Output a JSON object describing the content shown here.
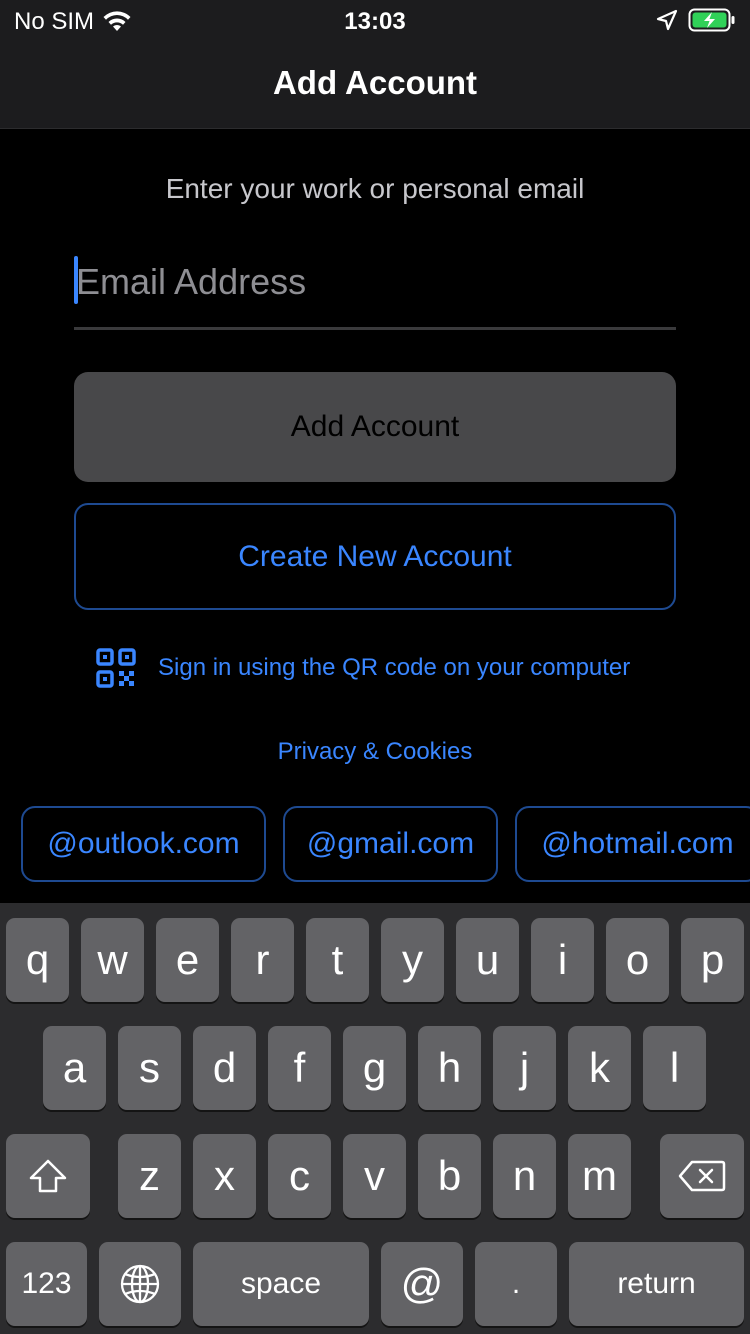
{
  "status_bar": {
    "carrier": "No SIM",
    "time": "13:03"
  },
  "nav": {
    "title": "Add Account"
  },
  "form": {
    "prompt": "Enter your work or personal email",
    "email_placeholder": "Email Address",
    "email_value": "",
    "add_account_label": "Add Account",
    "create_account_label": "Create New Account",
    "qr_label": "Sign in using the QR code on your computer",
    "privacy_label": "Privacy & Cookies"
  },
  "domain_suggestions": [
    "@outlook.com",
    "@gmail.com",
    "@hotmail.com"
  ],
  "keyboard": {
    "row1": [
      "q",
      "w",
      "e",
      "r",
      "t",
      "y",
      "u",
      "i",
      "o",
      "p"
    ],
    "row2": [
      "a",
      "s",
      "d",
      "f",
      "g",
      "h",
      "j",
      "k",
      "l"
    ],
    "row3": [
      "z",
      "x",
      "c",
      "v",
      "b",
      "n",
      "m"
    ],
    "numbers_label": "123",
    "space_label": "space",
    "at_label": "@",
    "dot_label": ".",
    "return_label": "return"
  },
  "colors": {
    "accent": "#3a86ff",
    "chip_border": "#1e4a91",
    "keyboard_bg": "#2c2c2e",
    "key_bg": "#636366",
    "key_dark_bg": "#434345",
    "battery_fill": "#30d158"
  },
  "icons": [
    "wifi-icon",
    "location-icon",
    "battery-charging-icon",
    "qr-code-icon",
    "shift-icon",
    "backspace-icon",
    "globe-icon"
  ]
}
